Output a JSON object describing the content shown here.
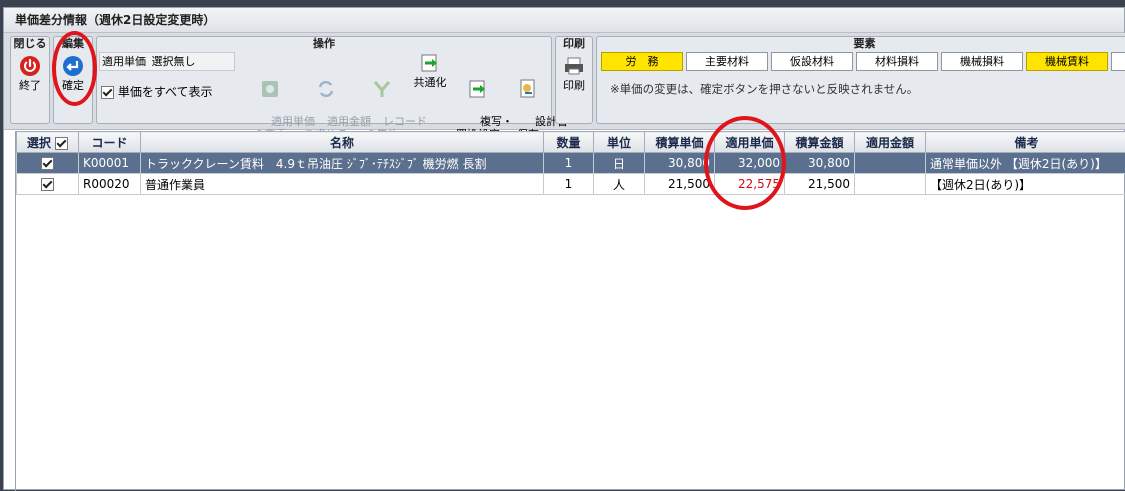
{
  "window": {
    "title": "単価差分情報（週休2日設定変更時）"
  },
  "ribbon": {
    "close_group": {
      "title": "閉じる",
      "exit_label": "終了"
    },
    "edit_group": {
      "title": "編集",
      "confirm_label": "確定"
    },
    "ops_group": {
      "title": "操作",
      "applied_price_label": "適用単価",
      "applied_price_value": "選択無し",
      "show_all_label": "単価をすべて表示",
      "change_price_label": "適用単価\nの変更",
      "calc_amount_label": "適用金額\nを求める",
      "aggregate_label": "レコード\nの集約",
      "share_label": "共通化",
      "copy_replace_label": "複写・\n置換設定",
      "save_doc_label": "設計書\n保存"
    },
    "print_group": {
      "title": "印刷",
      "print_label": "印刷"
    },
    "elements_group": {
      "title": "要素",
      "buttons": [
        "労　務",
        "主要材料",
        "仮設材料",
        "材料損料",
        "機械損料",
        "機械賃料"
      ],
      "note": "※単価の変更は、確定ボタンを押さないと反映されません。"
    }
  },
  "grid": {
    "headers": [
      "選択",
      "コード",
      "名称",
      "数量",
      "単位",
      "積算単価",
      "適用単価",
      "積算金額",
      "適用金額",
      "備考"
    ],
    "rows": [
      {
        "code": "K00001",
        "name": "トラッククレーン賃料　4.9ｔ吊油圧 ｼﾞﾌﾞ･ﾃﾁｽｼﾞﾌﾞ 機労燃 長割",
        "qty": "1",
        "unit": "日",
        "est_price": "30,800",
        "applied_price": "32,000",
        "est_amount": "30,800",
        "applied_amount": "",
        "remarks": "通常単価以外 【週休2日(あり)】"
      },
      {
        "code": "R00020",
        "name": "普通作業員",
        "qty": "1",
        "unit": "人",
        "est_price": "21,500",
        "applied_price": "22,575",
        "est_amount": "21,500",
        "applied_amount": "",
        "remarks": "【週休2日(あり)】"
      }
    ]
  },
  "colors": {
    "highlight_red": "#e0141b",
    "selected_row": "#5b6f8e",
    "element_active": "#ffe400"
  }
}
